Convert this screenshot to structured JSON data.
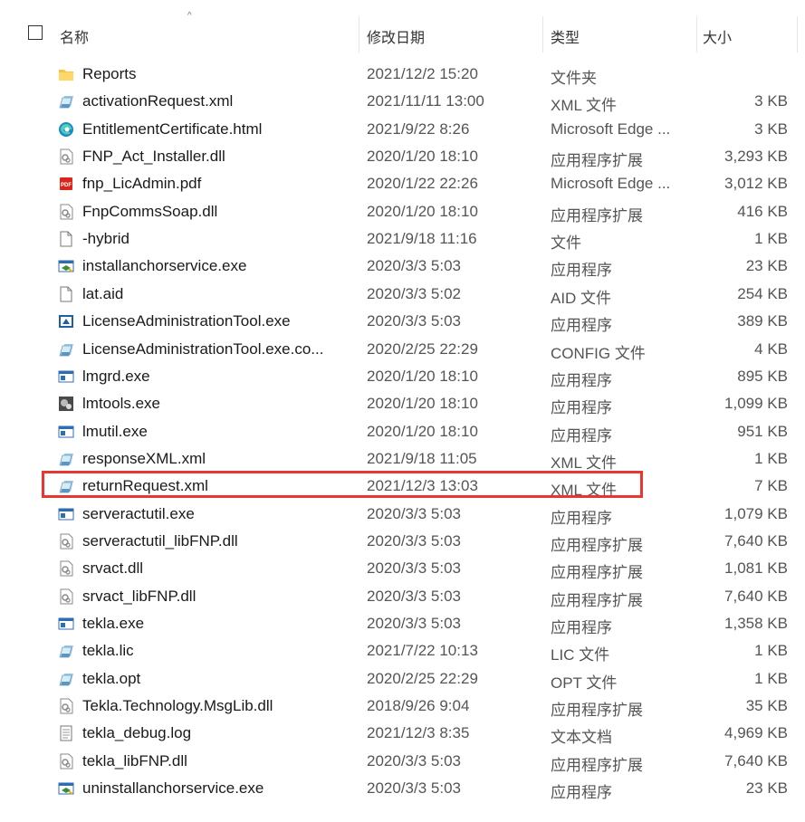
{
  "header": {
    "name": "名称",
    "date": "修改日期",
    "type": "类型",
    "size": "大小"
  },
  "colors": {
    "highlight": "#e8372f",
    "folder": "#f6c342"
  },
  "files": [
    {
      "name": "Reports",
      "date": "2021/12/2 15:20",
      "type": "文件夹",
      "size": "",
      "icon": "folder-icon"
    },
    {
      "name": "activationRequest.xml",
      "date": "2021/11/11 13:00",
      "type": "XML 文件",
      "size": "3 KB",
      "icon": "xml-file-icon"
    },
    {
      "name": "EntitlementCertificate.html",
      "date": "2021/9/22 8:26",
      "type": "Microsoft Edge ...",
      "size": "3 KB",
      "icon": "edge-icon"
    },
    {
      "name": "FNP_Act_Installer.dll",
      "date": "2020/1/20 18:10",
      "type": "应用程序扩展",
      "size": "3,293 KB",
      "icon": "dll-icon"
    },
    {
      "name": "fnp_LicAdmin.pdf",
      "date": "2020/1/22 22:26",
      "type": "Microsoft Edge ...",
      "size": "3,012 KB",
      "icon": "pdf-icon"
    },
    {
      "name": "FnpCommsSoap.dll",
      "date": "2020/1/20 18:10",
      "type": "应用程序扩展",
      "size": "416 KB",
      "icon": "dll-icon"
    },
    {
      "name": "-hybrid",
      "date": "2021/9/18 11:16",
      "type": "文件",
      "size": "1 KB",
      "icon": "blank-file-icon"
    },
    {
      "name": "installanchorservice.exe",
      "date": "2020/3/3 5:03",
      "type": "应用程序",
      "size": "23 KB",
      "icon": "installer-exe-icon"
    },
    {
      "name": "lat.aid",
      "date": "2020/3/3 5:02",
      "type": "AID 文件",
      "size": "254 KB",
      "icon": "blank-file-icon"
    },
    {
      "name": "LicenseAdministrationTool.exe",
      "date": "2020/3/3 5:03",
      "type": "应用程序",
      "size": "389 KB",
      "icon": "license-tool-icon"
    },
    {
      "name": "LicenseAdministrationTool.exe.co...",
      "date": "2020/2/25 22:29",
      "type": "CONFIG 文件",
      "size": "4 KB",
      "icon": "config-file-icon"
    },
    {
      "name": "lmgrd.exe",
      "date": "2020/1/20 18:10",
      "type": "应用程序",
      "size": "895 KB",
      "icon": "exe-icon"
    },
    {
      "name": "lmtools.exe",
      "date": "2020/1/20 18:10",
      "type": "应用程序",
      "size": "1,099 KB",
      "icon": "lmtools-icon"
    },
    {
      "name": "lmutil.exe",
      "date": "2020/1/20 18:10",
      "type": "应用程序",
      "size": "951 KB",
      "icon": "exe-icon"
    },
    {
      "name": "responseXML.xml",
      "date": "2021/9/18 11:05",
      "type": "XML 文件",
      "size": "1 KB",
      "icon": "xml-file-icon"
    },
    {
      "name": "returnRequest.xml",
      "date": "2021/12/3 13:03",
      "type": "XML 文件",
      "size": "7 KB",
      "icon": "xml-file-icon"
    },
    {
      "name": "serveractutil.exe",
      "date": "2020/3/3 5:03",
      "type": "应用程序",
      "size": "1,079 KB",
      "icon": "exe-icon"
    },
    {
      "name": "serveractutil_libFNP.dll",
      "date": "2020/3/3 5:03",
      "type": "应用程序扩展",
      "size": "7,640 KB",
      "icon": "dll-icon"
    },
    {
      "name": "srvact.dll",
      "date": "2020/3/3 5:03",
      "type": "应用程序扩展",
      "size": "1,081 KB",
      "icon": "dll-icon"
    },
    {
      "name": "srvact_libFNP.dll",
      "date": "2020/3/3 5:03",
      "type": "应用程序扩展",
      "size": "7,640 KB",
      "icon": "dll-icon"
    },
    {
      "name": "tekla.exe",
      "date": "2020/3/3 5:03",
      "type": "应用程序",
      "size": "1,358 KB",
      "icon": "exe-icon"
    },
    {
      "name": "tekla.lic",
      "date": "2021/7/22 10:13",
      "type": "LIC 文件",
      "size": "1 KB",
      "icon": "config-file-icon"
    },
    {
      "name": "tekla.opt",
      "date": "2020/2/25 22:29",
      "type": "OPT 文件",
      "size": "1 KB",
      "icon": "config-file-icon"
    },
    {
      "name": "Tekla.Technology.MsgLib.dll",
      "date": "2018/9/26 9:04",
      "type": "应用程序扩展",
      "size": "35 KB",
      "icon": "dll-icon"
    },
    {
      "name": "tekla_debug.log",
      "date": "2021/12/3 8:35",
      "type": "文本文档",
      "size": "4,969 KB",
      "icon": "text-file-icon"
    },
    {
      "name": "tekla_libFNP.dll",
      "date": "2020/3/3 5:03",
      "type": "应用程序扩展",
      "size": "7,640 KB",
      "icon": "dll-icon"
    },
    {
      "name": "uninstallanchorservice.exe",
      "date": "2020/3/3 5:03",
      "type": "应用程序",
      "size": "23 KB",
      "icon": "installer-exe-icon"
    }
  ]
}
